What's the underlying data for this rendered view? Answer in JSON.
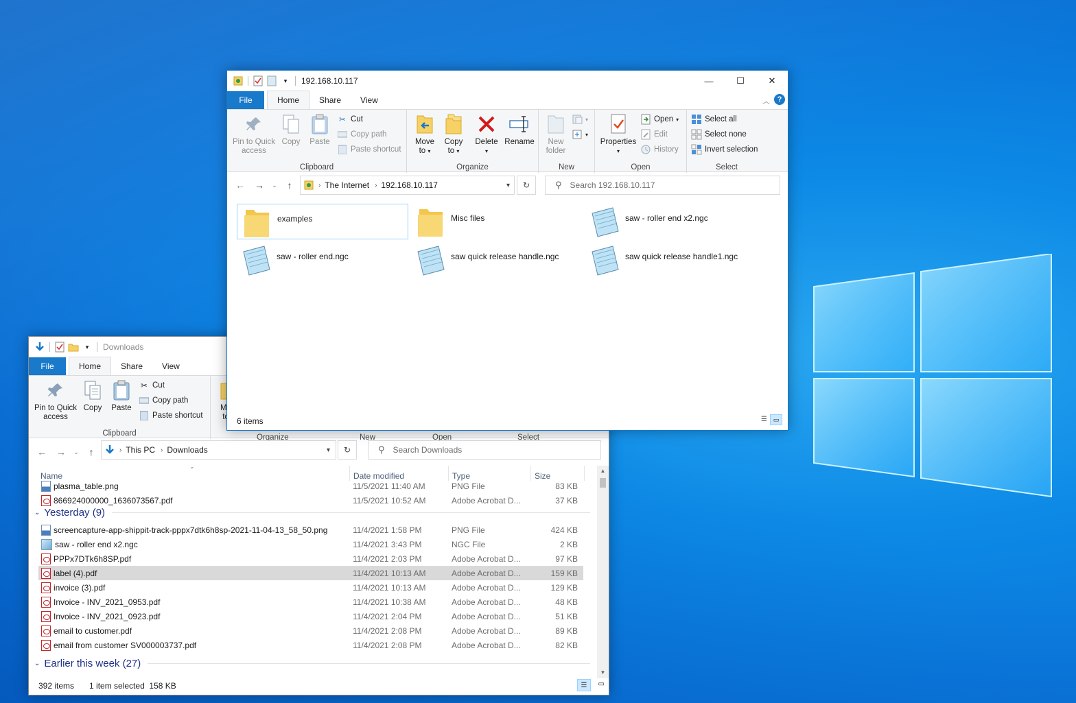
{
  "colors": {
    "accent": "#1979ca",
    "selection": "#cce8ff",
    "selected_row": "#d9d9d9"
  },
  "front": {
    "title": "192.168.10.117",
    "tabs": {
      "file": "File",
      "home": "Home",
      "share": "Share",
      "view": "View"
    },
    "ribbon": {
      "pin": "Pin to Quick access",
      "copy": "Copy",
      "paste": "Paste",
      "cut": "Cut",
      "copy_path": "Copy path",
      "paste_shortcut": "Paste shortcut",
      "clipboard": "Clipboard",
      "move_to": "Move to",
      "copy_to": "Copy to",
      "delete": "Delete",
      "rename": "Rename",
      "organize": "Organize",
      "new_folder": "New folder",
      "new": "New",
      "properties": "Properties",
      "open": "Open",
      "edit": "Edit",
      "history": "History",
      "open_group": "Open",
      "select_all": "Select all",
      "select_none": "Select none",
      "invert_selection": "Invert selection",
      "select": "Select"
    },
    "address": {
      "crumbs": [
        "The Internet",
        "192.168.10.117"
      ]
    },
    "search_placeholder": "Search 192.168.10.117",
    "items": [
      {
        "name": "examples",
        "kind": "folder"
      },
      {
        "name": "Misc files",
        "kind": "folder"
      },
      {
        "name": "saw - roller end x2.ngc",
        "kind": "ngc"
      },
      {
        "name": "saw - roller end.ngc",
        "kind": "ngc"
      },
      {
        "name": "saw quick release handle.ngc",
        "kind": "ngc"
      },
      {
        "name": "saw quick release handle1.ngc",
        "kind": "ngc"
      }
    ],
    "status": "6 items"
  },
  "back": {
    "title": "Downloads",
    "tabs": {
      "file": "File",
      "home": "Home",
      "share": "Share",
      "view": "View"
    },
    "ribbon": {
      "pin": "Pin to Quick access",
      "copy": "Copy",
      "paste": "Paste",
      "cut": "Cut",
      "copy_path": "Copy path",
      "paste_shortcut": "Paste shortcut",
      "clipboard": "Clipboard",
      "move_partial": "Mo",
      "to_partial": "to",
      "organize": "Organize",
      "new": "New",
      "open": "Open",
      "select": "Select"
    },
    "address": {
      "crumbs": [
        "This PC",
        "Downloads"
      ]
    },
    "search_placeholder": "Search Downloads",
    "columns": {
      "name": "Name",
      "date": "Date modified",
      "type": "Type",
      "size": "Size"
    },
    "top_rows": [
      {
        "name": "plasma_table.png",
        "date": "11/5/2021 11:40 AM",
        "type": "PNG File",
        "size": "83 KB",
        "icon": "png"
      },
      {
        "name": "866924000000_1636073567.pdf",
        "date": "11/5/2021 10:52 AM",
        "type": "Adobe Acrobat D...",
        "size": "37 KB",
        "icon": "pdf"
      }
    ],
    "group_yesterday": "Yesterday (9)",
    "yesterday_rows": [
      {
        "name": "screencapture-app-shippit-track-pppx7dtk6h8sp-2021-11-04-13_58_50.png",
        "date": "11/4/2021 1:58 PM",
        "type": "PNG File",
        "size": "424 KB",
        "icon": "png"
      },
      {
        "name": "saw - roller end x2.ngc",
        "date": "11/4/2021 3:43 PM",
        "type": "NGC File",
        "size": "2 KB",
        "icon": "ngc"
      },
      {
        "name": "PPPx7DTk6h8SP.pdf",
        "date": "11/4/2021 2:03 PM",
        "type": "Adobe Acrobat D...",
        "size": "97 KB",
        "icon": "pdf"
      },
      {
        "name": "label (4).pdf",
        "date": "11/4/2021 10:13 AM",
        "type": "Adobe Acrobat D...",
        "size": "159 KB",
        "icon": "pdf"
      },
      {
        "name": "invoice (3).pdf",
        "date": "11/4/2021 10:13 AM",
        "type": "Adobe Acrobat D...",
        "size": "129 KB",
        "icon": "pdf"
      },
      {
        "name": "Invoice - INV_2021_0953.pdf",
        "date": "11/4/2021 10:38 AM",
        "type": "Adobe Acrobat D...",
        "size": "48 KB",
        "icon": "pdf"
      },
      {
        "name": "Invoice - INV_2021_0923.pdf",
        "date": "11/4/2021 2:04 PM",
        "type": "Adobe Acrobat D...",
        "size": "51 KB",
        "icon": "pdf"
      },
      {
        "name": "email to customer.pdf",
        "date": "11/4/2021 2:08 PM",
        "type": "Adobe Acrobat D...",
        "size": "89 KB",
        "icon": "pdf"
      },
      {
        "name": "email from customer SV000003737.pdf",
        "date": "11/4/2021 2:08 PM",
        "type": "Adobe Acrobat D...",
        "size": "82 KB",
        "icon": "pdf"
      }
    ],
    "group_earlier": "Earlier this week (27)",
    "status_items": "392 items",
    "status_selected": "1 item selected  158 KB"
  }
}
